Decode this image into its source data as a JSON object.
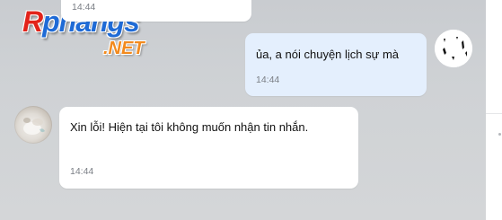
{
  "watermark": {
    "logo_first_letter": "R",
    "logo_rest": "phangs",
    "logo_domain": ".NET"
  },
  "messages": [
    {
      "id": "partial-top",
      "direction": "received",
      "text": "",
      "time": "14:44"
    },
    {
      "id": "sent-1",
      "direction": "sent",
      "text": "ủa, a nói chuyện lịch sự mà",
      "time": "14:44"
    },
    {
      "id": "received-1",
      "direction": "received",
      "text": "Xin lỗi! Hiện tại tôi không muốn nhận tin nhắn.",
      "time": "14:44"
    }
  ],
  "colors": {
    "sent_bubble": "#e4effd",
    "received_bubble": "#ffffff",
    "background": "#cfd2d5",
    "time_text": "#7a7e85"
  }
}
